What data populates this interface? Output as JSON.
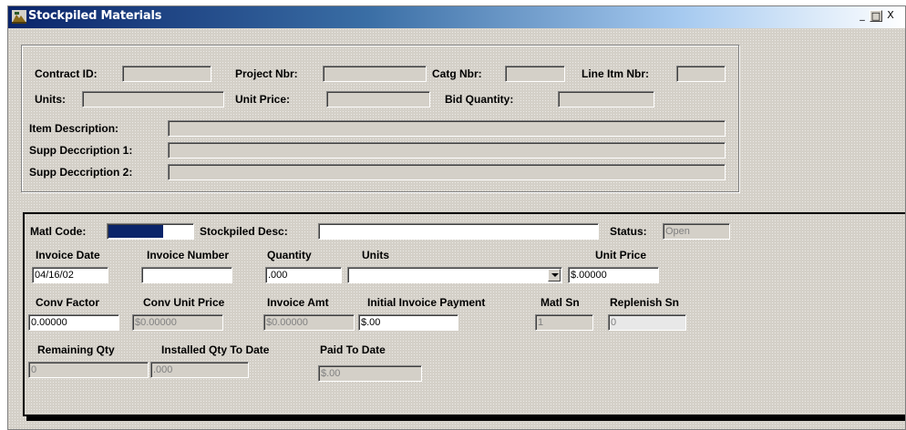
{
  "window": {
    "title": "Stockpiled Materials",
    "controls": {
      "minimize": "_",
      "maximize": "□",
      "close": "X"
    }
  },
  "header": {
    "contract_id_label": "Contract ID:",
    "project_nbr_label": "Project Nbr:",
    "catg_nbr_label": "Catg Nbr:",
    "line_itm_nbr_label": "Line Itm Nbr:",
    "units_label": "Units:",
    "unit_price_label": "Unit Price:",
    "bid_quantity_label": "Bid Quantity:",
    "item_description_label": "Item Description:",
    "supp_desc1_label": "Supp Deccription 1:",
    "supp_desc2_label": "Supp Deccription 2:",
    "contract_id": "",
    "project_nbr": "",
    "catg_nbr": "",
    "line_itm_nbr": "",
    "units": "",
    "unit_price": "",
    "bid_quantity": "",
    "item_description": "",
    "supp_desc1": "",
    "supp_desc2": ""
  },
  "detail": {
    "matl_code_label": "Matl Code:",
    "matl_code": "",
    "stockpiled_desc_label": "Stockpiled Desc:",
    "stockpiled_desc": "",
    "status_label": "Status:",
    "status": "Open",
    "invoice_date_label": "Invoice Date",
    "invoice_date": "04/16/02",
    "invoice_number_label": "Invoice Number",
    "invoice_number": "",
    "quantity_label": "Quantity",
    "quantity": ".000",
    "units_label": "Units",
    "units": "",
    "unit_price_label": "Unit Price",
    "unit_price": "$.00000",
    "conv_factor_label": "Conv Factor",
    "conv_factor": "0.00000",
    "conv_unit_price_label": "Conv Unit Price",
    "conv_unit_price": "$0.00000",
    "invoice_amt_label": "Invoice Amt",
    "invoice_amt": "$0.00000",
    "initial_invoice_payment_label": "Initial Invoice Payment",
    "initial_invoice_payment": "$.00",
    "matl_sn_label": "Matl Sn",
    "matl_sn": "1",
    "replenish_sn_label": "Replenish Sn",
    "replenish_sn": "0",
    "remaining_qty_label": "Remaining Qty",
    "remaining_qty": "0",
    "installed_qty_label": "Installed Qty To Date",
    "installed_qty": ".000",
    "paid_to_date_label": "Paid To Date",
    "paid_to_date": "$.00"
  }
}
